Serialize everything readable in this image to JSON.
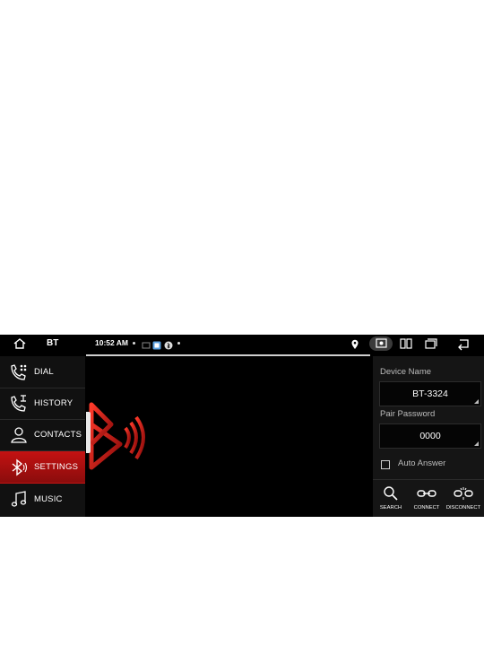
{
  "status_bar": {
    "title": "BT",
    "time": "10:52 AM",
    "icons": [
      "home-icon",
      "location-icon",
      "screenshot-icon",
      "split-screen-icon",
      "recent-apps-icon",
      "back-icon"
    ]
  },
  "sidebar": {
    "items": [
      {
        "label": "DIAL",
        "icon": "phone-dialpad-icon",
        "active": false
      },
      {
        "label": "HISTORY",
        "icon": "call-history-icon",
        "active": false
      },
      {
        "label": "CONTACTS",
        "icon": "contacts-icon",
        "active": false
      },
      {
        "label": "SETTINGS",
        "icon": "bluetooth-icon",
        "active": true
      },
      {
        "label": "MUSIC",
        "icon": "music-icon",
        "active": false
      }
    ]
  },
  "panel": {
    "device_name_label": "Device Name",
    "device_name_value": "BT-3324",
    "pair_password_label": "Pair Password",
    "pair_password_value": "0000",
    "auto_answer_label": "Auto Answer",
    "auto_answer_checked": false,
    "actions": [
      {
        "label": "SEARCH",
        "icon": "search-icon"
      },
      {
        "label": "CONNECT",
        "icon": "connect-icon"
      },
      {
        "label": "DISCONNECT",
        "icon": "disconnect-icon"
      }
    ]
  },
  "colors": {
    "accent": "#c41212",
    "background": "#000000",
    "panel": "#151515"
  }
}
